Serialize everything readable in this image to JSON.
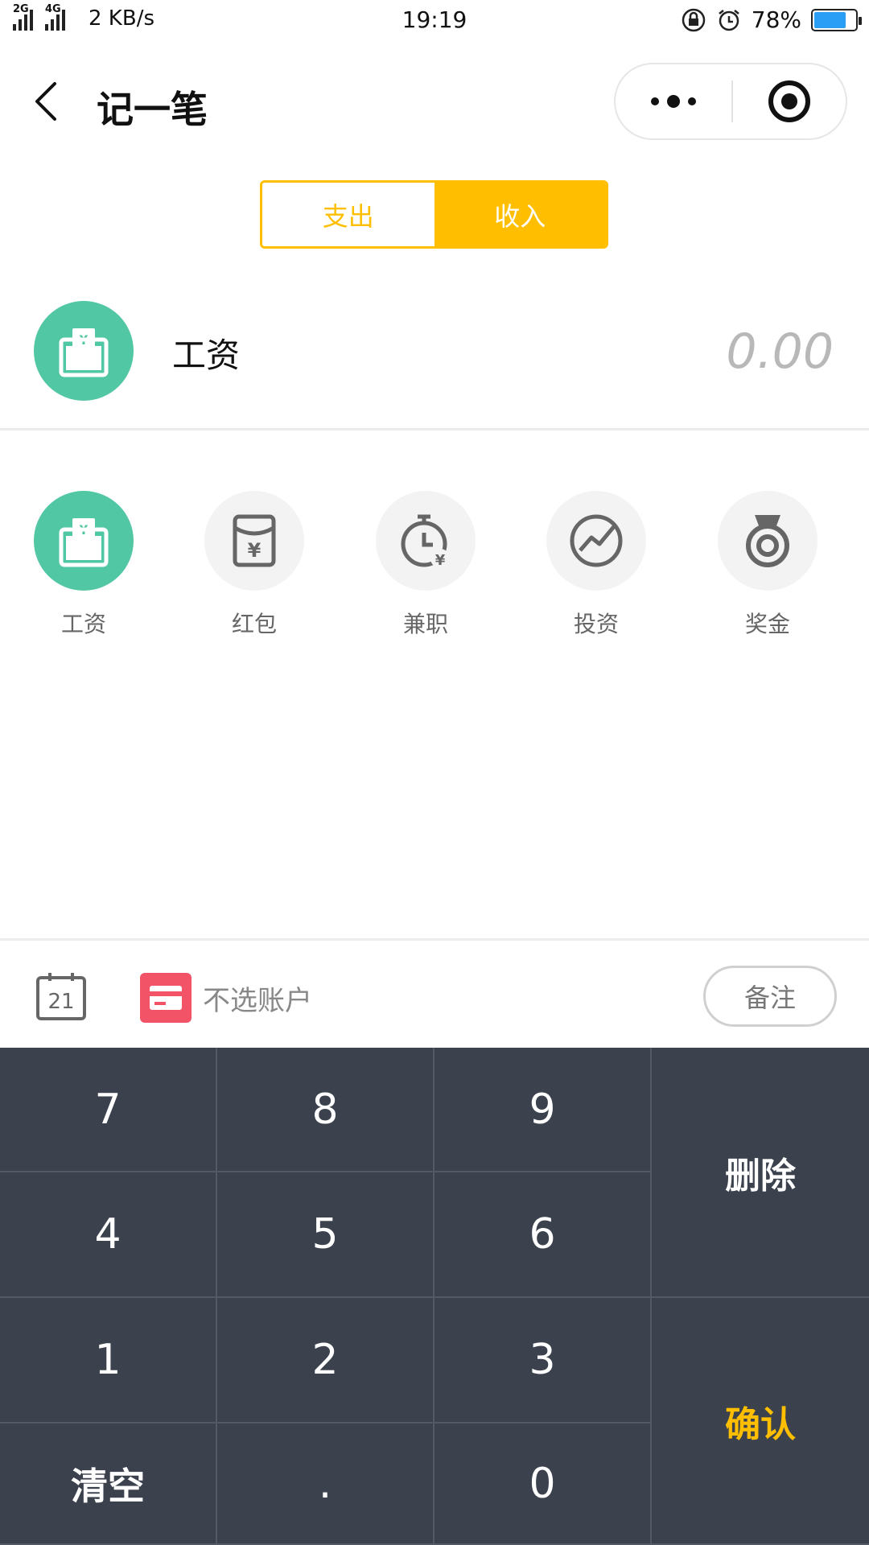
{
  "status_bar": {
    "signal_1_label": "2G",
    "signal_2_label": "4G",
    "net_speed": "2 KB/s",
    "time": "19:19",
    "battery": "78%",
    "battery_level": 0.78,
    "battery_color": "#2a9df4",
    "icons": [
      "signal-icon",
      "signal-icon",
      "rotation-lock-icon",
      "alarm-icon",
      "battery-icon"
    ]
  },
  "nav": {
    "title": "记一笔",
    "back_icon": "chevron-left-icon",
    "more_icon": "more-dots-icon",
    "close_icon": "target-icon"
  },
  "tabs": {
    "items": [
      "支出",
      "收入"
    ],
    "selected": "收入",
    "accent": "#ffbf00"
  },
  "selected_category": {
    "name": "工资",
    "amount": "0.00",
    "icon": "wallet-yen-icon",
    "color": "#52c7a4"
  },
  "categories": [
    {
      "label": "工资",
      "icon": "wallet-yen-icon",
      "active": true
    },
    {
      "label": "红包",
      "icon": "red-envelope-yen-icon",
      "active": false
    },
    {
      "label": "兼职",
      "icon": "stopwatch-yen-icon",
      "active": false
    },
    {
      "label": "投资",
      "icon": "trend-chart-icon",
      "active": false
    },
    {
      "label": "奖金",
      "icon": "medal-icon",
      "active": false
    }
  ],
  "toolbar": {
    "date_day": "21",
    "account_label": "不选账户",
    "account_color": "#f35367",
    "note_label": "备注"
  },
  "keypad": {
    "keys": [
      "7",
      "8",
      "9",
      "4",
      "5",
      "6",
      "1",
      "2",
      "3",
      "清空",
      ".",
      "0"
    ],
    "delete_label": "删除",
    "confirm_label": "确认",
    "background": "#3b414d"
  }
}
